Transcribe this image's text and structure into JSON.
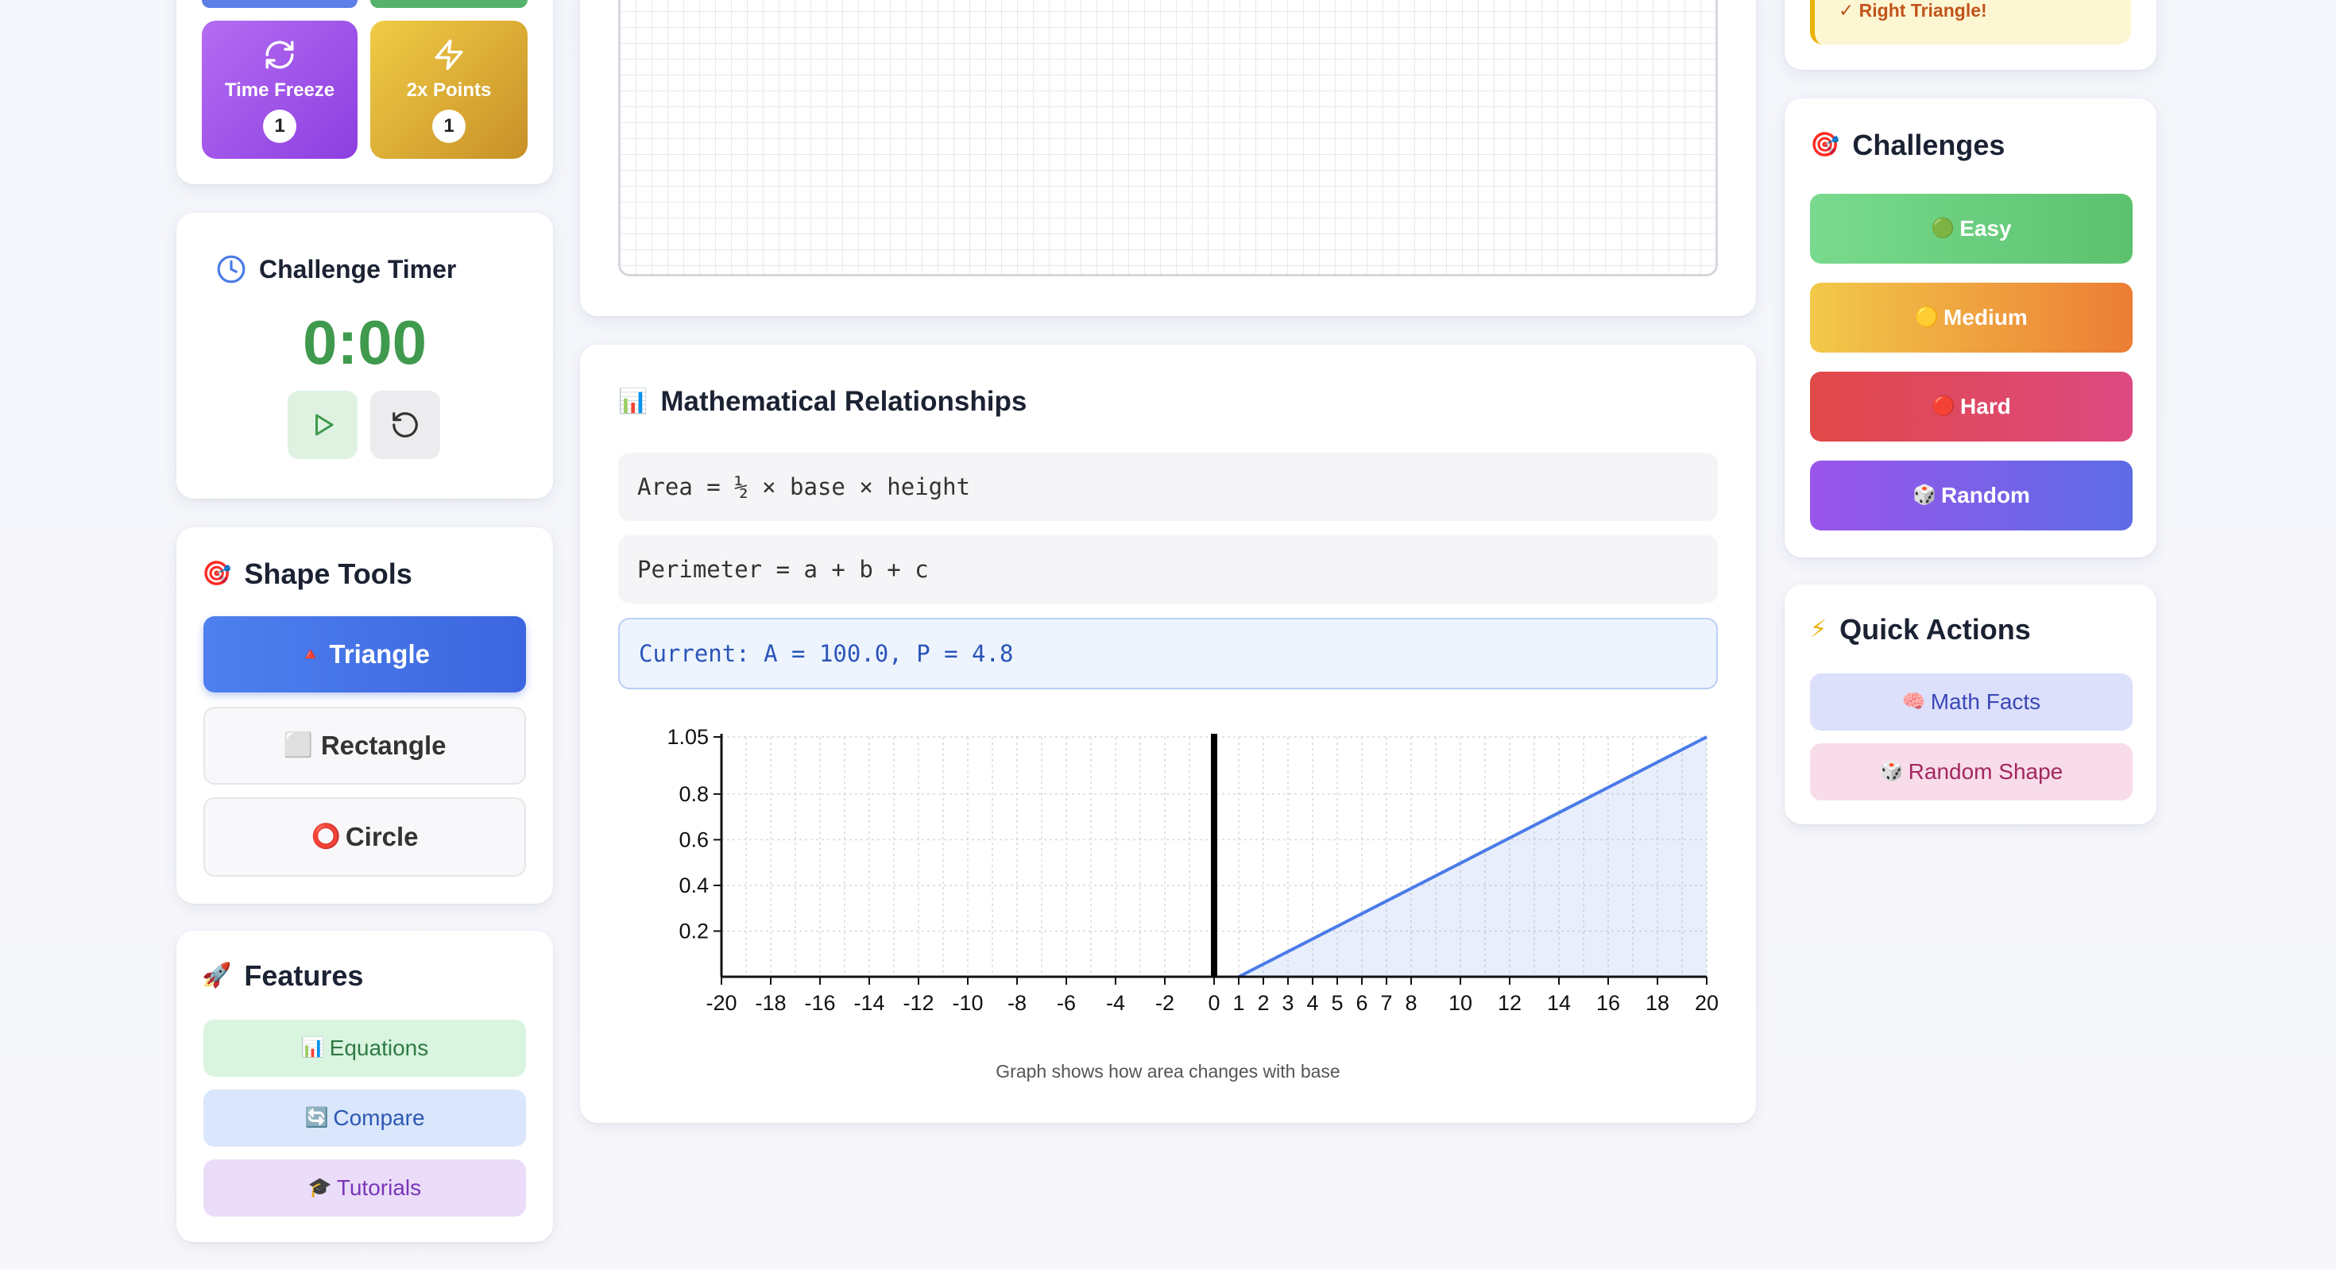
{
  "powerups": [
    {
      "label": "Time Freeze",
      "count": "1",
      "icon": "refresh-icon"
    },
    {
      "label": "2x Points",
      "count": "1",
      "icon": "lightning-icon"
    }
  ],
  "timer": {
    "title": "Challenge Timer",
    "value": "0:00"
  },
  "shape_tools": {
    "title": "Shape Tools",
    "title_emoji": "🎯",
    "items": [
      {
        "emoji": "🔺",
        "label": "Triangle"
      },
      {
        "emoji": "⬜",
        "label": "Rectangle"
      },
      {
        "emoji": "⭕",
        "label": "Circle"
      }
    ]
  },
  "features": {
    "title": "Features",
    "title_emoji": "🚀",
    "items": [
      {
        "emoji": "📊",
        "label": "Equations"
      },
      {
        "emoji": "🔄",
        "label": "Compare"
      },
      {
        "emoji": "🎓",
        "label": "Tutorials"
      }
    ]
  },
  "relationships": {
    "title": "Mathematical Relationships",
    "title_emoji": "📊",
    "area_formula": "Area = ½ × base × height",
    "perimeter_formula": "Perimeter = a + b + c",
    "current": "Current: A = 100.0, P = 4.8",
    "caption": "Graph shows how area changes with base"
  },
  "status": {
    "message": "✓ Right Triangle!"
  },
  "challenges": {
    "title": "Challenges",
    "title_emoji": "🎯",
    "items": [
      {
        "emoji": "🟢",
        "label": "Easy"
      },
      {
        "emoji": "🟡",
        "label": "Medium"
      },
      {
        "emoji": "🔴",
        "label": "Hard"
      },
      {
        "emoji": "🎲",
        "label": "Random"
      }
    ]
  },
  "quick_actions": {
    "title": "Quick Actions",
    "title_emoji": "⚡",
    "items": [
      {
        "emoji": "🧠",
        "label": "Math Facts"
      },
      {
        "emoji": "🎲",
        "label": "Random Shape"
      }
    ]
  },
  "colors": {
    "accent_blue": "#4a7be8",
    "timer_green": "#3f9a4e",
    "easy_green": "#6cd084",
    "medium_gradient": "#f0c544",
    "hard_red": "#e0484f",
    "random_purple": "#7b5ce8"
  },
  "chart_data": {
    "type": "area",
    "title": "",
    "xlabel": "",
    "ylabel": "",
    "xlim": [
      -20,
      20
    ],
    "ylim": [
      0,
      1.05
    ],
    "x_ticks": [
      "-20",
      "-18",
      "-16",
      "-14",
      "-12",
      "-10",
      "-8",
      "-6",
      "-4",
      "-2",
      "0",
      "1",
      "2",
      "3",
      "4",
      "5",
      "6",
      "7",
      "8",
      "10",
      "12",
      "14",
      "16",
      "18",
      "20"
    ],
    "y_ticks": [
      "1.05",
      "0.8",
      "0.6",
      "0.4",
      "0.2"
    ],
    "grid": true,
    "series": [
      {
        "values": [
          [
            1,
            0.0
          ],
          [
            20,
            1.05
          ]
        ]
      }
    ]
  }
}
